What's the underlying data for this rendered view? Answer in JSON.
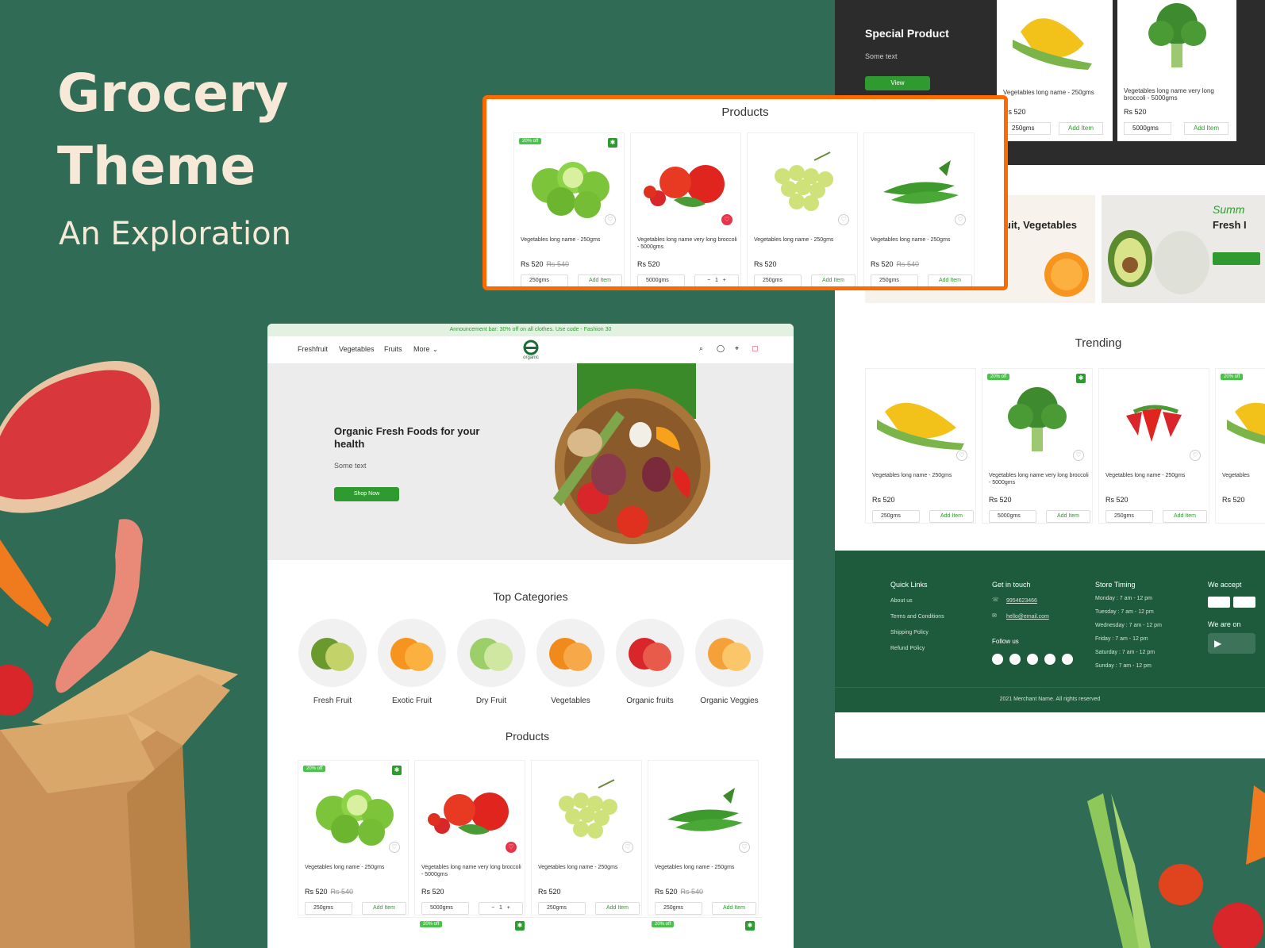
{
  "hero": {
    "title_line1": "Grocery",
    "title_line2": "Theme",
    "subtitle": "An Exploration"
  },
  "colors": {
    "background": "#2f6b55",
    "accent_green": "#2f9a2f",
    "highlight_orange": "#ff6a00",
    "footer": "#1e5a3c",
    "cream": "#f6e9d8"
  },
  "main_site": {
    "announcement": "Announcement bar: 30% off on all clothes. Use code - Fashion 30",
    "nav": [
      "Freshfruit",
      "Vegetables",
      "Fruits",
      "More"
    ],
    "logo_text": "organic",
    "banner": {
      "headline": "Organic Fresh Foods for your health",
      "sub": "Some text",
      "button": "Shop Now"
    },
    "categories_title": "Top Categories",
    "categories": [
      "Fresh Fruit",
      "Exotic Fruit",
      "Dry Fruit",
      "Vegetables",
      "Organic fruits",
      "Organic Veggies"
    ],
    "products_title": "Products",
    "products": [
      {
        "name": "Vegetables long name - 250gms",
        "price": "Rs 520",
        "old_price": "Rs 540",
        "select": "250gms",
        "action": "Add Item",
        "badge": "20% off",
        "favorite": false
      },
      {
        "name": "Vegetables long name very long broccoli - 5000gms",
        "price": "Rs 520",
        "old_price": "",
        "select": "5000gms",
        "qty": "1",
        "favorite": true
      },
      {
        "name": "Vegetables long name - 250gms",
        "price": "Rs 520",
        "old_price": "",
        "select": "250gms",
        "action": "Add Item",
        "favorite": false
      },
      {
        "name": "Vegetables long name - 250gms",
        "price": "Rs 520",
        "old_price": "Rs 540",
        "select": "250gms",
        "action": "Add Item",
        "favorite": false
      }
    ],
    "row2_badges": [
      "20% off",
      "20% off"
    ]
  },
  "zoom_panel": {
    "title": "Products"
  },
  "right_site": {
    "special": {
      "title": "Special Product",
      "text": "Some text",
      "button": "View"
    },
    "special_products": [
      {
        "name": "Vegetables long name - 250gms",
        "price": "Rs 520",
        "select": "250gms",
        "action": "Add Item"
      },
      {
        "name": "Vegetables long name very long broccoli - 5000gms",
        "price": "Rs 520",
        "select": "5000gms",
        "action": "Add Item"
      }
    ],
    "promo1": "uit, Vegetables",
    "promo2_title": "Fresh I",
    "promo2_script": "Summ",
    "trending_title": "Trending",
    "trending": [
      {
        "name": "Vegetables long name - 250gms",
        "price": "Rs 520",
        "select": "250gms",
        "action": "Add Item"
      },
      {
        "name": "Vegetables long name very long broccoli - 5000gms",
        "price": "Rs 520",
        "select": "5000gms",
        "action": "Add Item",
        "badge": "20% off"
      },
      {
        "name": "Vegetables long name - 250gms",
        "price": "Rs 520",
        "select": "250gms",
        "action": "Add Item"
      },
      {
        "name": "Vegetables",
        "price": "Rs 520",
        "badge": "20% off"
      }
    ],
    "footer": {
      "quick_links_title": "Quick Links",
      "quick_links": [
        "About us",
        "Terms and Conditions",
        "Shipping Policy",
        "Refund Policy"
      ],
      "contact_title": "Get in touch",
      "phone": "9954623466",
      "email": "hello@email.com",
      "follow": "Follow us",
      "timing_title": "Store Timing",
      "timings": [
        "Monday : 7 am - 12 pm",
        "Tuesday : 7 am - 12 pm",
        "Wednesday : 7 am - 12 pm",
        "Friday : 7 am - 12 pm",
        "Saturday : 7 am - 12 pm",
        "Sunday : 7 am - 12 pm"
      ],
      "accept_title": "We accept",
      "app_title": "We are on",
      "copyright": "2021 Merchant Name. All rights reserved"
    }
  }
}
